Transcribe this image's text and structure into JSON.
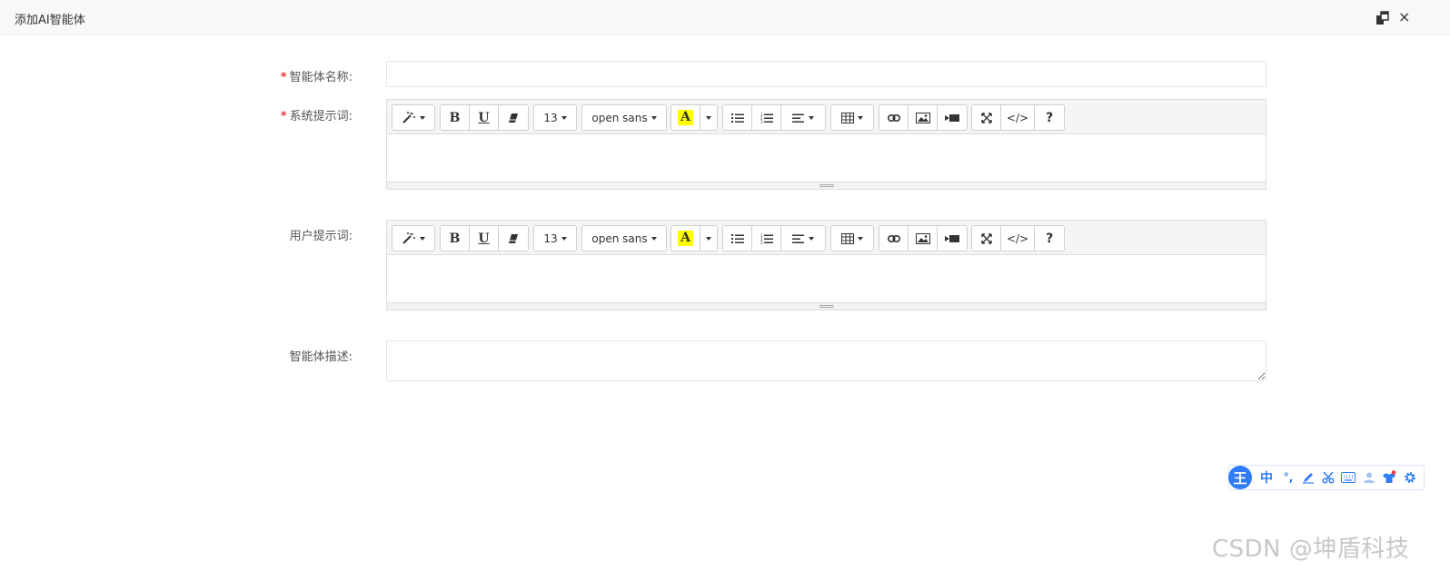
{
  "window": {
    "title": "添加AI智能体",
    "maximize_icon": "maximize-icon",
    "close_symbol": "×"
  },
  "form": {
    "name_label": "智能体名称:",
    "name_required": "*",
    "name_value": "",
    "system_prompt_label": "系统提示词:",
    "system_prompt_required": "*",
    "user_prompt_label": "用户提示词:",
    "description_label": "智能体描述:",
    "description_value": ""
  },
  "toolbar": {
    "font_size": "13",
    "font_family": "open sans",
    "color_letter": "A",
    "bold_label": "B",
    "underline_label": "U",
    "code_label": "</>",
    "help_label": "?",
    "highlight_color": "#ffff00"
  },
  "ime": {
    "logo": "王",
    "chinese": "中",
    "punct": "°,",
    "accent_color": "#2f7cf6"
  },
  "watermark": "CSDN @坤盾科技"
}
